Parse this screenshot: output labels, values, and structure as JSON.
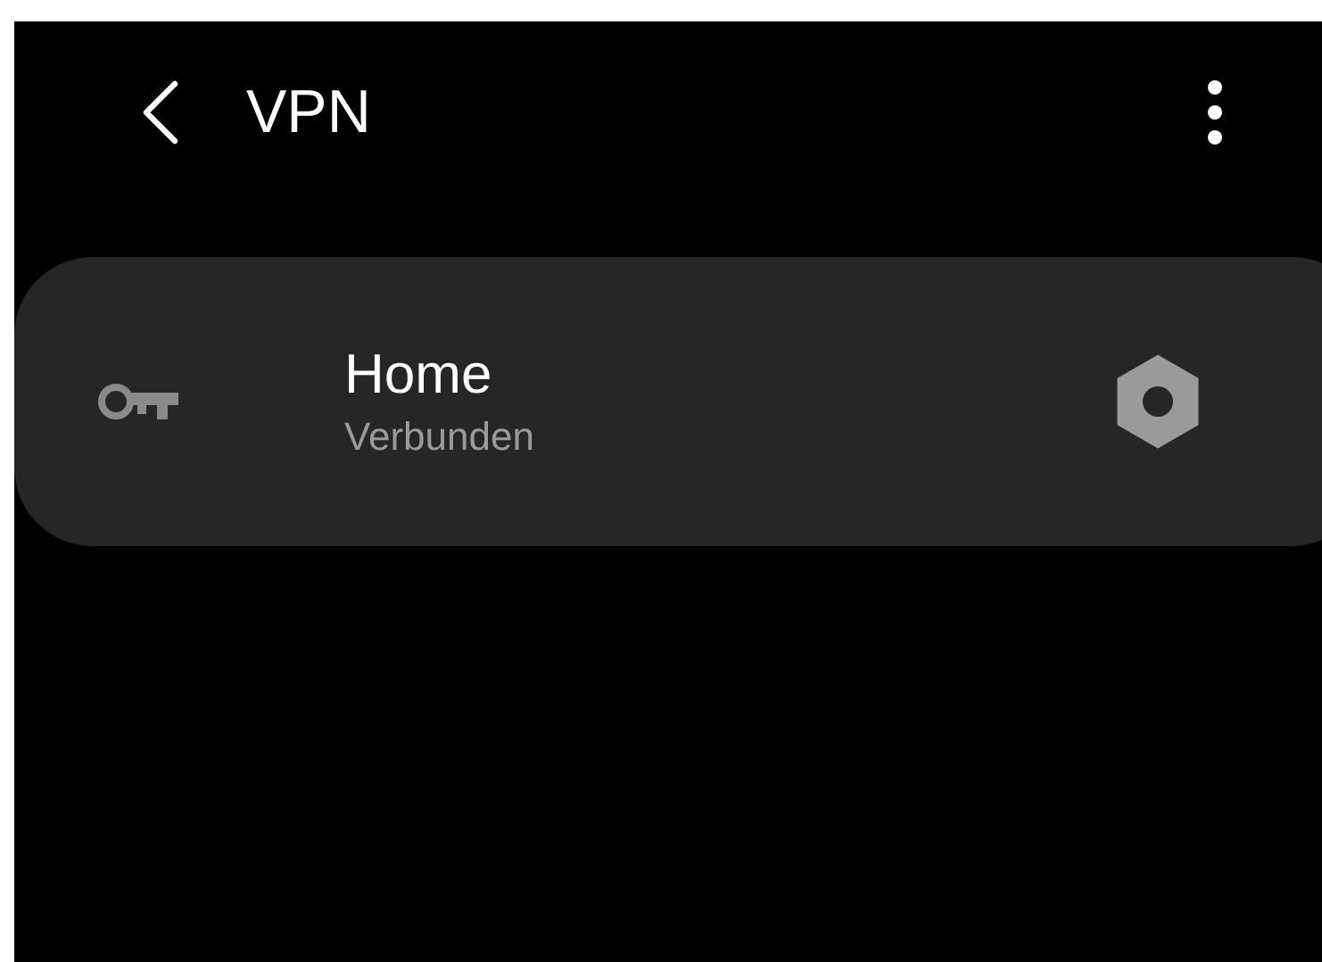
{
  "header": {
    "title": "VPN"
  },
  "vpn_profiles": [
    {
      "name": "Home",
      "status": "Verbunden"
    }
  ]
}
